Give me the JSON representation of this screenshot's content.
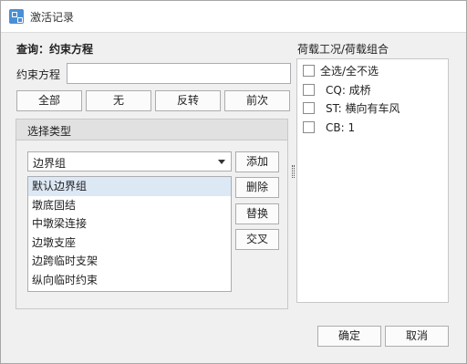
{
  "window": {
    "title": "激活记录",
    "icon": "app-grid-icon"
  },
  "query": {
    "title": "查询：约束方程",
    "field_label": "约束方程",
    "field_value": "",
    "buttons": [
      "全部",
      "无",
      "反转",
      "前次"
    ]
  },
  "select_type": {
    "title": "选择类型",
    "combo_value": "边界组",
    "list_items": [
      "默认边界组",
      "墩底固结",
      "中墩梁连接",
      "边墩支座",
      "边跨临时支架",
      "纵向临时约束"
    ],
    "selected_index": 0,
    "buttons": [
      "添加",
      "删除",
      "替换",
      "交叉"
    ]
  },
  "load_cases": {
    "title": "荷载工况/荷载组合",
    "select_all": "全选/全不选",
    "items": [
      "CQ: 成桥",
      "ST: 横向有车风",
      "CB: 1"
    ]
  },
  "footer": {
    "ok": "确定",
    "cancel": "取消"
  }
}
